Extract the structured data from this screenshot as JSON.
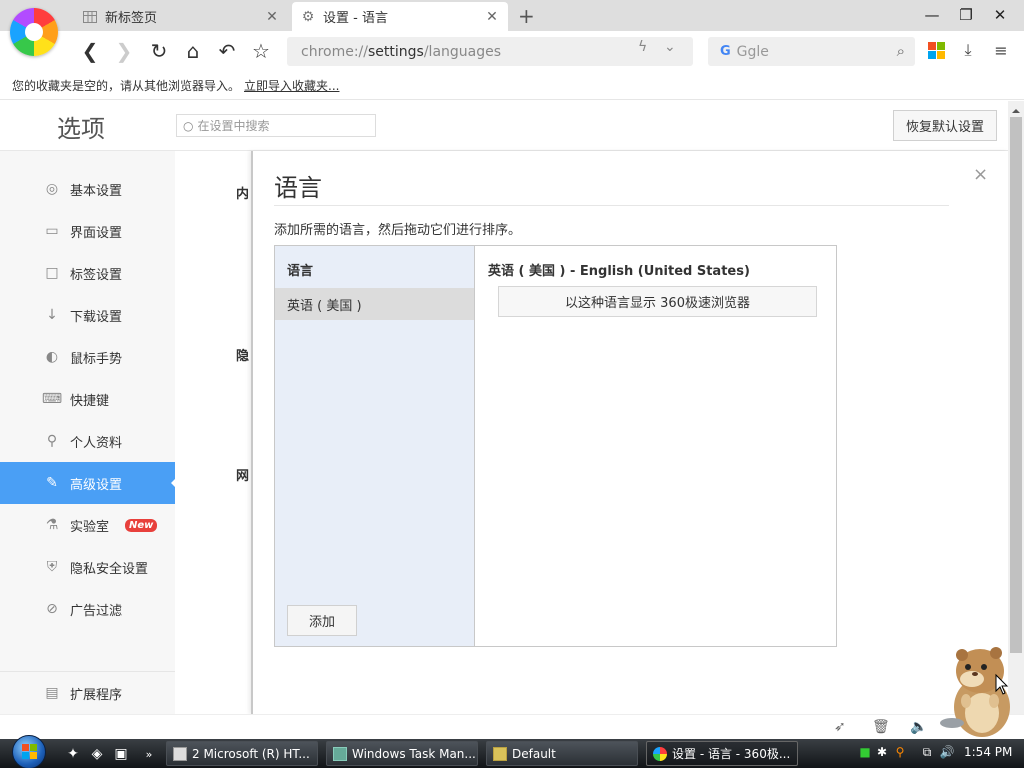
{
  "tabs": [
    {
      "title": "新标签页",
      "icon": "grid-icon",
      "active": false
    },
    {
      "title": "设置 - 语言",
      "icon": "gear-icon",
      "active": true
    }
  ],
  "toolbar": {
    "url_prefix": "chrome://",
    "url_host": "settings",
    "url_path": "/languages",
    "search_placeholder": "Ggle"
  },
  "bookmarks": {
    "empty_text": "您的收藏夹是空的，请从其他浏览器导入。",
    "import_link": "立即导入收藏夹..."
  },
  "settings": {
    "title": "选项",
    "search_placeholder": "在设置中搜索",
    "restore_button": "恢复默认设置",
    "nav": [
      {
        "label": "基本设置",
        "icon": "circle-icon"
      },
      {
        "label": "界面设置",
        "icon": "window-icon"
      },
      {
        "label": "标签设置",
        "icon": "tab-icon"
      },
      {
        "label": "下载设置",
        "icon": "download-icon"
      },
      {
        "label": "鼠标手势",
        "icon": "mouse-icon"
      },
      {
        "label": "快捷键",
        "icon": "keyboard-icon"
      },
      {
        "label": "个人资料",
        "icon": "person-icon"
      },
      {
        "label": "高级设置",
        "icon": "wrench-icon",
        "active": true
      },
      {
        "label": "实验室",
        "icon": "flask-icon",
        "badge": "New"
      },
      {
        "label": "隐私安全设置",
        "icon": "shield-icon"
      },
      {
        "label": "广告过滤",
        "icon": "block-icon"
      }
    ],
    "extensions": {
      "label": "扩展程序",
      "icon": "extension-icon"
    },
    "behind_labels": [
      "内",
      "隐",
      "网"
    ]
  },
  "dialog": {
    "title": "语言",
    "description": "添加所需的语言，然后拖动它们进行排序。",
    "list_header": "语言",
    "languages": [
      "英语 ( 美国 )"
    ],
    "add_button": "添加",
    "detail_header": "英语 ( 美国 )  - English (United States)",
    "display_button": "以这种语言显示 360极速浏览器",
    "close": "×"
  },
  "taskbar": {
    "buttons": [
      {
        "label": "2 Microsoft (R) HT...",
        "icon": "console-icon"
      },
      {
        "label": "Windows Task Man...",
        "icon": "taskmanager-icon"
      },
      {
        "label": "Default",
        "icon": "folder-icon"
      },
      {
        "label": "设置 - 语言 - 360极...",
        "icon": "browser-icon",
        "active": true
      }
    ],
    "clock": "1:54 PM"
  },
  "colors": {
    "accent": "#4a9ff5",
    "badge": "#e8403c",
    "dialog_list_bg": "#e8eef8"
  }
}
